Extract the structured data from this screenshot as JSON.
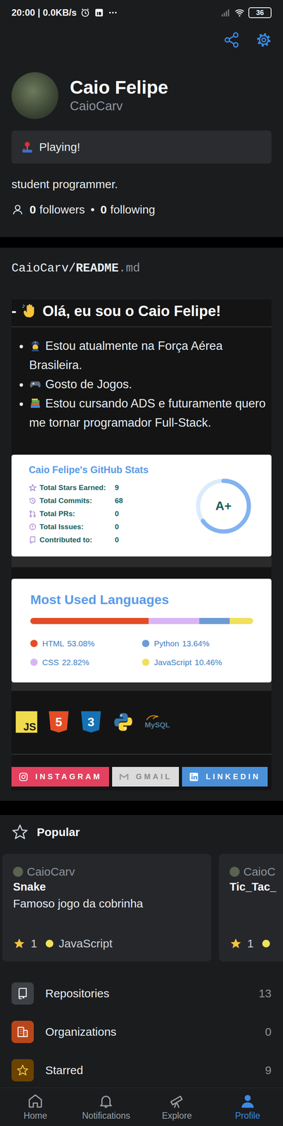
{
  "status_bar": {
    "time": "20:00 | 0.0KB/s",
    "battery": "36"
  },
  "profile": {
    "name": "Caio Felipe",
    "username": "CaioCarv",
    "status": "Playing!",
    "bio": "student programmer.",
    "followers": "0",
    "followers_label": "followers",
    "separator": "•",
    "following": "0",
    "following_label": "following"
  },
  "readme": {
    "path": "CaioCarv/",
    "file": "README",
    "ext": ".md",
    "heading_prefix": "-",
    "heading": "Olá, eu sou o Caio Felipe!",
    "bullets": [
      {
        "kind": "officer",
        "text": "Estou atualmente na Força Aérea Brasileira."
      },
      {
        "kind": "gamepad",
        "text": "Gosto de Jogos."
      },
      {
        "kind": "books",
        "text": "Estou cursando ADS e futuramente quero me tornar programador Full-Stack."
      }
    ]
  },
  "stats_card": {
    "title": "Caio Felipe's GitHub Stats",
    "rank": "A+",
    "level": 0.65,
    "rows": [
      {
        "kind": "star",
        "label": "Total Stars Earned:",
        "value": "9"
      },
      {
        "kind": "commits",
        "label": "Total Commits:",
        "value": "68"
      },
      {
        "kind": "pr",
        "label": "Total PRs:",
        "value": "0"
      },
      {
        "kind": "issue",
        "label": "Total Issues:",
        "value": "0"
      },
      {
        "kind": "repo",
        "label": "Contributed to:",
        "value": "0"
      }
    ]
  },
  "languages_card": {
    "title": "Most Used Languages",
    "languages": [
      {
        "name": "HTML",
        "percent": "53.08%",
        "level": 0.5308,
        "color": "#e34c26"
      },
      {
        "name": "CSS",
        "percent": "22.82%",
        "level": 0.2282,
        "color": "#d9b5f4"
      },
      {
        "name": "Python",
        "percent": "13.64%",
        "level": 0.1364,
        "color": "#6d9bd4"
      },
      {
        "name": "JavaScript",
        "percent": "10.46%",
        "level": 0.1046,
        "color": "#f1e05a"
      }
    ]
  },
  "skills": [
    {
      "kind": "js",
      "label": "JS"
    },
    {
      "kind": "html",
      "label": "5"
    },
    {
      "kind": "css",
      "label": "3"
    },
    {
      "kind": "python"
    },
    {
      "kind": "mysql",
      "label": "MySQL"
    }
  ],
  "badges": [
    {
      "kind": "instagram",
      "label": "INSTAGRAM",
      "color": "#e4405f"
    },
    {
      "kind": "gmail",
      "label": "GMAIL",
      "color": "#dcdcdc"
    },
    {
      "kind": "linkedin",
      "label": "LINKEDIN",
      "color": "#4a90d9"
    }
  ],
  "popular": {
    "title": "Popular",
    "repos": [
      {
        "owner": "CaioCarv",
        "name": "Snake",
        "description": "Famoso jogo da cobrinha",
        "stars": "1",
        "language": "JavaScript",
        "color": "#f1e05a"
      },
      {
        "owner": "CaioC",
        "name": "Tic_Tac_",
        "stars": "1",
        "color": "#f1e05a"
      }
    ]
  },
  "menu": [
    {
      "kind": "repo",
      "label": "Repositories",
      "count": "13",
      "color": "#3d4045"
    },
    {
      "kind": "org",
      "label": "Organizations",
      "count": "0",
      "color": "#b8461a"
    },
    {
      "kind": "star",
      "label": "Starred",
      "count": "9",
      "color": "#6b4300"
    }
  ],
  "nav": [
    {
      "kind": "home",
      "label": "Home",
      "selected": false
    },
    {
      "kind": "bell",
      "label": "Notifications",
      "selected": false
    },
    {
      "kind": "explore",
      "label": "Explore",
      "selected": false
    },
    {
      "kind": "profile",
      "label": "Profile",
      "selected": true
    }
  ]
}
